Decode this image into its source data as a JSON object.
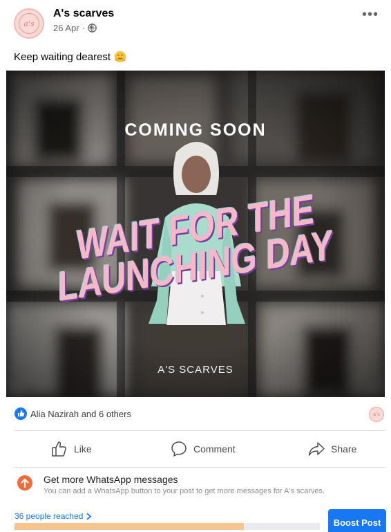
{
  "post": {
    "page_name": "A's scarves",
    "date": "26 Apr",
    "separator": "·",
    "more_label": "•••",
    "avatar_text": "a's",
    "text": "Keep waiting dearest"
  },
  "image": {
    "coming_soon": "COMING SOON",
    "headline_line1": "WAIT FOR THE",
    "headline_line2": "LAUNCHING DAY",
    "brand": "A'S SCARVES"
  },
  "reactions": {
    "summary": "Alia Nazirah and 6 others",
    "avatar_text": "a's"
  },
  "actions": {
    "like_label": "Like",
    "comment_label": "Comment",
    "share_label": "Share"
  },
  "promo": {
    "title": "Get more WhatsApp messages",
    "subtitle": "You can add a WhatsApp button to your post to get more messages for A's scarves."
  },
  "reach": {
    "text": "36 people reached",
    "progress_fraction": 0.75,
    "boost_label": "Boost Post"
  },
  "colors": {
    "accent": "#1877f2",
    "promo_icon": "#f26b3a",
    "progress_fill": "#f7c48f",
    "headline_pink": "#f4b8c6"
  },
  "icons": [
    "more-icon",
    "globe-icon",
    "hug-emoji-icon",
    "like-badge-icon",
    "thumbs-up-icon",
    "comment-icon",
    "share-icon",
    "arrow-up-icon",
    "chevron-right-icon"
  ]
}
